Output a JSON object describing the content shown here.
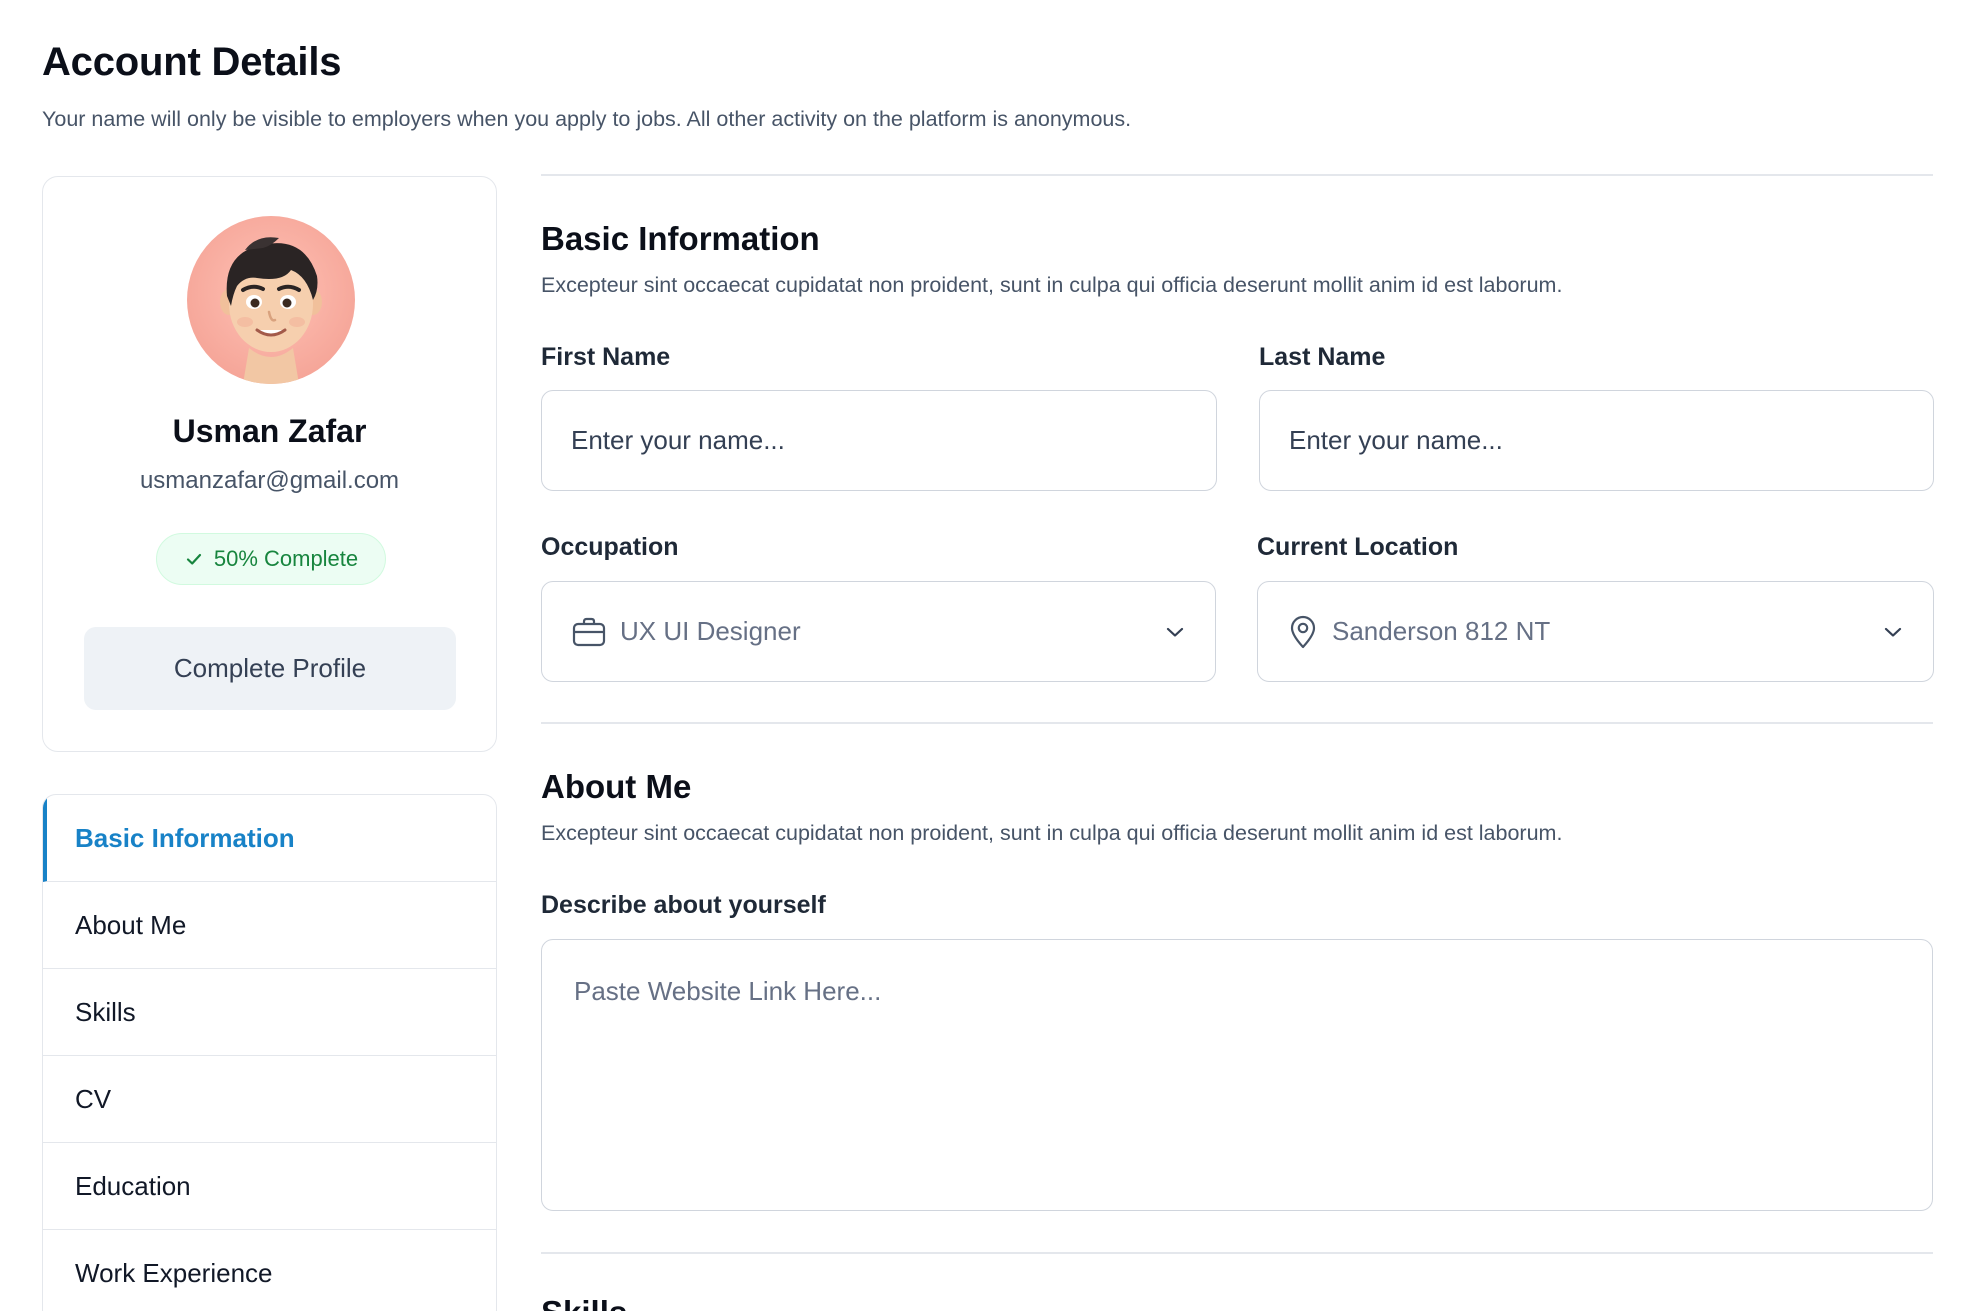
{
  "page": {
    "title": "Account Details",
    "subtitle": "Your name will only be visible to employers when you apply to jobs. All other activity on the platform is anonymous."
  },
  "profile": {
    "name": "Usman Zafar",
    "email": "usmanzafar@gmail.com",
    "progress_label": "50% Complete",
    "progress_percent": 50,
    "complete_button": "Complete Profile"
  },
  "nav": {
    "items": [
      {
        "label": "Basic Information",
        "active": true
      },
      {
        "label": "About Me",
        "active": false
      },
      {
        "label": "Skills",
        "active": false
      },
      {
        "label": "CV",
        "active": false
      },
      {
        "label": "Education",
        "active": false
      },
      {
        "label": "Work Experience",
        "active": false
      }
    ]
  },
  "basic_info": {
    "title": "Basic Information",
    "description": "Excepteur sint occaecat cupidatat non proident, sunt in culpa qui officia deserunt mollit anim id est laborum.",
    "first_name": {
      "label": "First Name",
      "placeholder": "Enter your name...",
      "value": ""
    },
    "last_name": {
      "label": "Last Name",
      "placeholder": "Enter your name...",
      "value": ""
    },
    "occupation": {
      "label": "Occupation",
      "value": "UX UI Designer",
      "icon": "briefcase-icon"
    },
    "location": {
      "label": "Current Location",
      "value": "Sanderson 812 NT",
      "icon": "map-pin-icon"
    }
  },
  "about_me": {
    "title": "About Me",
    "description": "Excepteur sint occaecat cupidatat non proident, sunt in culpa qui officia deserunt mollit anim id est laborum.",
    "describe": {
      "label": "Describe about yourself",
      "placeholder": "Paste Website Link Here...",
      "value": ""
    }
  },
  "skills": {
    "title": "Skills"
  },
  "colors": {
    "accent": "#1882c7",
    "success": "#17853e",
    "success_bg": "#ecfdf3",
    "avatar_bg": "#f6a79a"
  }
}
